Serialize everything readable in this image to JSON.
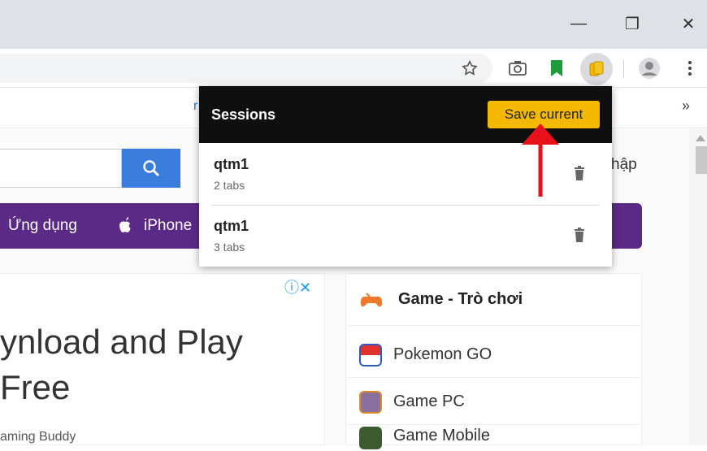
{
  "window": {
    "minimize": "—",
    "restore": "❐",
    "close": "✕"
  },
  "bookmarks": {
    "partial_text": "r",
    "more": "»"
  },
  "page": {
    "login_partial": "hập",
    "nav": {
      "apps": "Ứng dụng",
      "iphone": "iPhone"
    },
    "ad": {
      "line1": "ynload and Play",
      "line2": "Free",
      "sub": "aming Buddy",
      "icons": "ⓘ✕"
    },
    "sidebar": {
      "heading": "Game - Trò chơi",
      "items": [
        {
          "label": "Pokemon GO"
        },
        {
          "label": "Game PC"
        },
        {
          "label": "Game Mobile"
        }
      ]
    }
  },
  "popup": {
    "title": "Sessions",
    "save_label": "Save current",
    "sessions": [
      {
        "name": "qtm1",
        "count": "2 tabs"
      },
      {
        "name": "qtm1",
        "count": "3 tabs"
      }
    ]
  },
  "colors": {
    "accent": "#f5b800",
    "arrow": "#e8101a",
    "nav": "#5b2a86",
    "search": "#3b7ddd"
  }
}
